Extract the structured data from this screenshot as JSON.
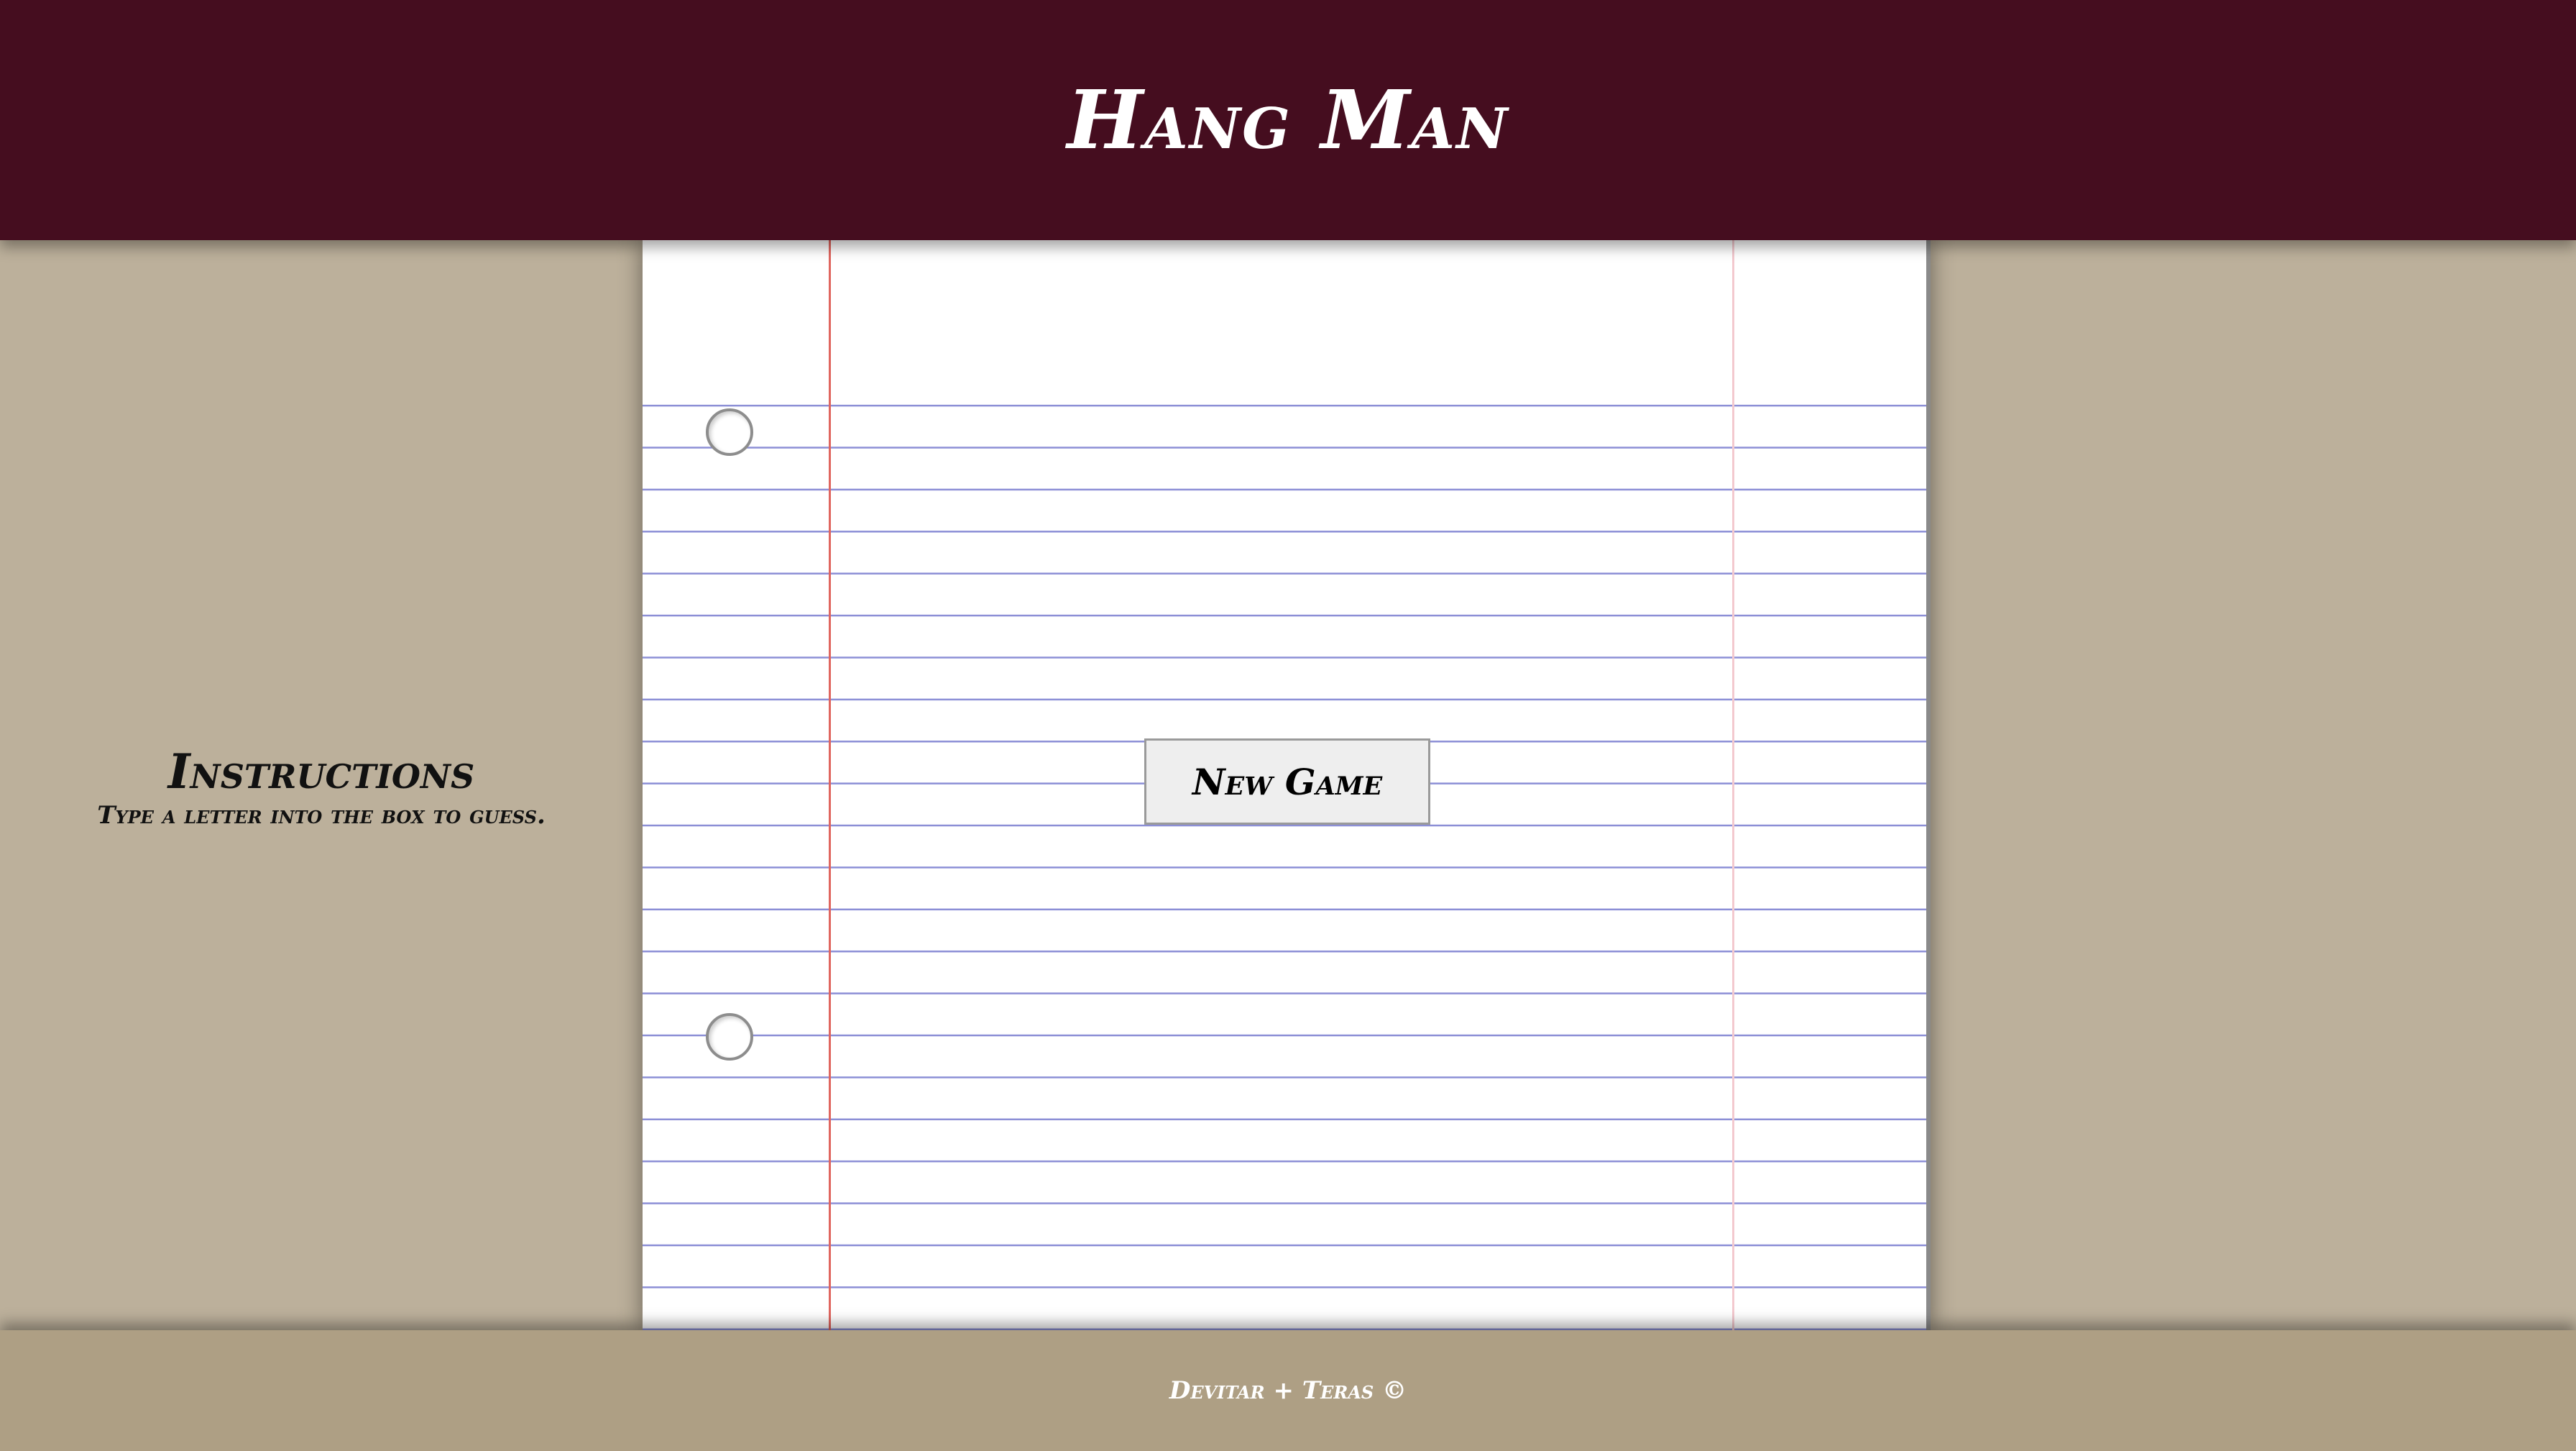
{
  "header": {
    "title": "Hang Man"
  },
  "instructions": {
    "title": "Instructions",
    "text": "Type a letter into the box to guess."
  },
  "game": {
    "new_game_label": "New Game"
  },
  "footer": {
    "text": "Devitar + Teras ©"
  },
  "colors": {
    "header_bg": "#450d1f",
    "page_bg": "#bcb09b",
    "footer_bg": "#ae9f84",
    "paper_line": "#8c8fd6",
    "margin_line": "#e0665f"
  }
}
